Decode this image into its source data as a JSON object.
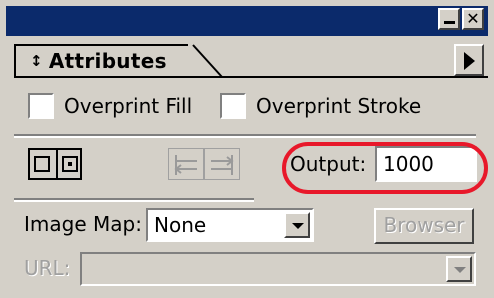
{
  "tab": {
    "label": "Attributes",
    "arrows_glyph": "↕"
  },
  "window": {
    "close_glyph": "✕"
  },
  "overprint": {
    "fill_label": "Overprint Fill",
    "stroke_label": "Overprint Stroke"
  },
  "output": {
    "label": "Output:",
    "value": "1000"
  },
  "image_map": {
    "label": "Image Map:",
    "value": "None",
    "browser_label": "Browser"
  },
  "url": {
    "label": "URL:",
    "value": ""
  },
  "colors": {
    "title_bar": "#0b2a6b",
    "panel_bg": "#d4d0c8",
    "highlight": "#e8182a"
  }
}
